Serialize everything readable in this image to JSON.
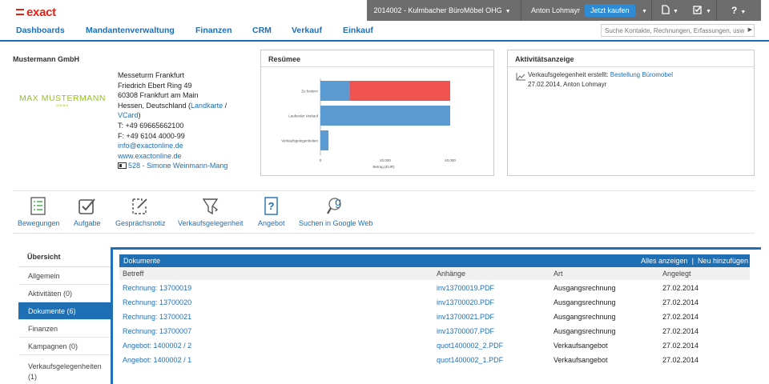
{
  "topbar": {
    "logo": "exact",
    "company": "2014002 - Kulmbacher BüroMöbel OHG",
    "user": "Anton Lohmayr",
    "buy_label": "Jetzt kaufen",
    "icons": [
      "document-icon",
      "checkbox-icon",
      "help-icon"
    ],
    "help_label": "?"
  },
  "nav": {
    "items": [
      "Dashboards",
      "Mandantenverwaltung",
      "Finanzen",
      "CRM",
      "Verkauf",
      "Einkauf"
    ],
    "search_placeholder": "Suche Kontakte, Rechnungen, Erfassungen, usw."
  },
  "company": {
    "title": "Mustermann GmbH",
    "brand_name": "MAX MUSTERMANN",
    "brand_sub": "GMBH",
    "address": {
      "line1": "Messeturm Frankfurt",
      "line2": "Friedrich Ebert Ring 49",
      "line3": "60308 Frankfurt am Main",
      "line4": "Hessen, Deutschland (",
      "map_link": "Landkarte",
      "slash": " / ",
      "vcard": "VCard",
      "close": ")",
      "phone": "T: +49 69665662100",
      "fax": "F: +49 6104 4000-99",
      "email": "info@exactonline.de",
      "web": "www.exactonline.de",
      "account_manager": "528 - Simone Weinmann-Mang"
    }
  },
  "resumee": {
    "title": "Resümee"
  },
  "chart_data": {
    "type": "bar",
    "orientation": "horizontal",
    "stacked": true,
    "categories": [
      "Zu fordern",
      "Laufender Verkauf",
      "Verkaufsgelegenheiten"
    ],
    "series": [
      {
        "color": "#5b9bd1",
        "values": [
          9000,
          40000,
          2500
        ]
      },
      {
        "color": "#ef5350",
        "values": [
          31000,
          0,
          0
        ]
      }
    ],
    "xlabel": "Betrag (EUR)",
    "ticks": [
      "0",
      "20.000",
      "40.000"
    ],
    "xlim": [
      0,
      40000
    ]
  },
  "activity": {
    "title": "Aktivitätsanzeige",
    "text_prefix": "Verkaufsgelegenheit erstellt: ",
    "link": "Bestellung Büromobel",
    "meta": "27.02.2014, Anton Lohmayr"
  },
  "toolbar": {
    "bewegungen": "Bewegungen",
    "aufgabe": "Aufgabe",
    "notiz": "Gesprächsnotiz",
    "gelegenheit": "Verkaufsgelegenheit",
    "angebot": "Angebot",
    "google": "Suchen in Google Web"
  },
  "sidebar": {
    "header": "Übersicht",
    "items": [
      "Allgemein",
      "Aktivitäten (0)",
      "Dokumente (6)",
      "Finanzen",
      "Kampagnen (0)",
      "Verkaufsgelegenheiten",
      "(1)"
    ]
  },
  "documents": {
    "title": "Dokumente",
    "show_all": "Alles anzeigen",
    "separator": "|",
    "add_new": "Neu hinzufügen",
    "columns": [
      "Betreff",
      "Anhänge",
      "Art",
      "Angelegt"
    ],
    "rows": [
      [
        "Rechnung: 13700019",
        "inv13700019.PDF",
        "Ausgangsrechnung",
        "27.02.2014"
      ],
      [
        "Rechnung: 13700020",
        "inv13700020.PDF",
        "Ausgangsrechnung",
        "27.02.2014"
      ],
      [
        "Rechnung: 13700021",
        "inv13700021.PDF",
        "Ausgangsrechnung",
        "27.02.2014"
      ],
      [
        "Rechnung: 13700007",
        "inv13700007.PDF",
        "Ausgangsrechnung",
        "27.02.2014"
      ],
      [
        "Angebot: 1400002 / 2",
        "quot1400002_2.PDF",
        "Verkaufsangebot",
        "27.02.2014"
      ],
      [
        "Angebot: 1400002 / 1",
        "quot1400002_1.PDF",
        "Verkaufsangebot",
        "27.02.2014"
      ]
    ]
  }
}
